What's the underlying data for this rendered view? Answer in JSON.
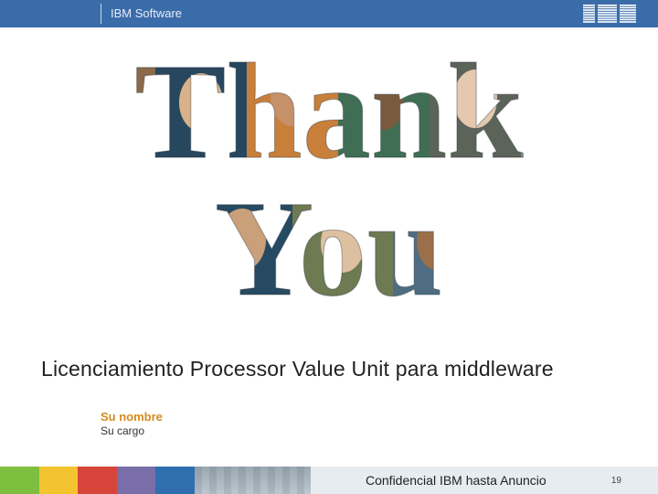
{
  "header": {
    "product_line": "IBM Software",
    "logo_alt": "IBM"
  },
  "hero": {
    "main_text": "Thank You"
  },
  "title": "Licenciamiento Processor Value Unit para middleware",
  "presenter": {
    "name": "Su nombre",
    "role": "Su cargo"
  },
  "footer": {
    "confidentiality": "Confidencial IBM hasta Anuncio",
    "page_number": "19"
  },
  "colors": {
    "header_bg": "#3b6caa",
    "accent_orange": "#d48b1f"
  }
}
